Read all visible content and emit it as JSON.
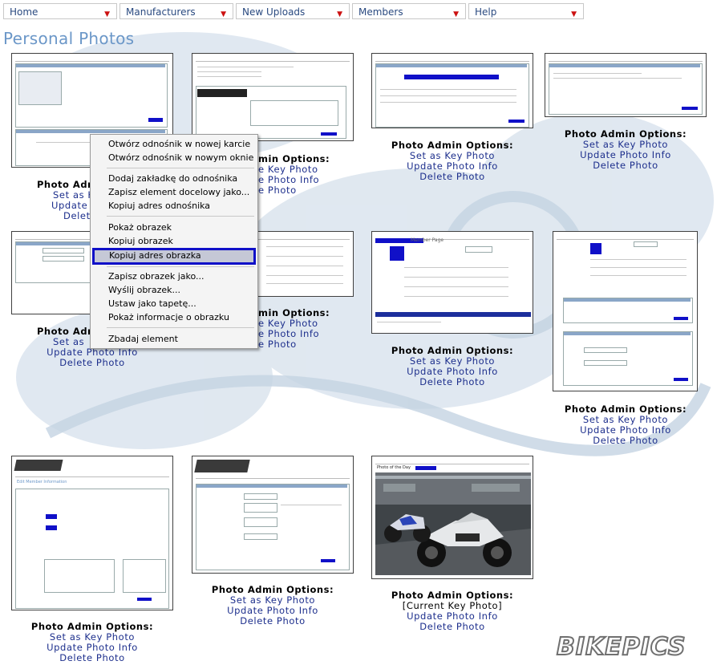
{
  "nav": {
    "items": [
      {
        "label": "Home"
      },
      {
        "label": "Manufacturers"
      },
      {
        "label": "New Uploads"
      },
      {
        "label": "Members"
      },
      {
        "label": "Help"
      }
    ]
  },
  "page_title": "Personal Photos",
  "captions": {
    "title": "Photo Admin Options:",
    "set_key": "Set as Key Photo",
    "update": "Update Photo Info",
    "delete": "Delete Photo",
    "current_key": "[Current Key Photo]"
  },
  "partial": {
    "title_a": "Photo Adm",
    "set_a": "Set as K",
    "update_a": "Update P",
    "delete_a": "Delete",
    "title_b": "Photo Adm",
    "set_b": "Set as",
    "update_b": "Update Photo Info",
    "delete_b": "Delete Photo",
    "title_c": "min Options:",
    "set_c": "e Key Photo",
    "update_c": "e Photo Info",
    "delete_c": "e Photo",
    "title_d": "min Options:",
    "set_d": "e Key Photo",
    "update_d": "e Photo Info",
    "delete_d": "e Photo"
  },
  "context_menu": {
    "open_new_tab": "Otwórz odnośnik w nowej karcie",
    "open_new_window": "Otwórz odnośnik w nowym oknie",
    "bookmark_link": "Dodaj zakładkę do odnośnika",
    "save_link_as": "Zapisz element docelowy jako...",
    "copy_link": "Kopiuj adres odnośnika",
    "view_image": "Pokaż obrazek",
    "copy_image": "Kopiuj obrazek",
    "copy_image_address": "Kopiuj adres obrazka",
    "save_image_as": "Zapisz obrazek jako...",
    "send_image": "Wyślij obrazek...",
    "set_background": "Ustaw jako tapetę...",
    "image_info": "Pokaż informacje o obrazku",
    "inspect": "Zbadaj element"
  },
  "thumb_labels": {
    "member_page": "Member Page",
    "photo_of_day": "Photo of the Day",
    "edit_member": "Edit Member Information"
  },
  "logo_text": "BIKEPICS",
  "colors": {
    "link": "#1c2e8c",
    "title": "#6b97c8",
    "nav_arrow": "#cc1010",
    "selection_border": "#1010c8"
  }
}
